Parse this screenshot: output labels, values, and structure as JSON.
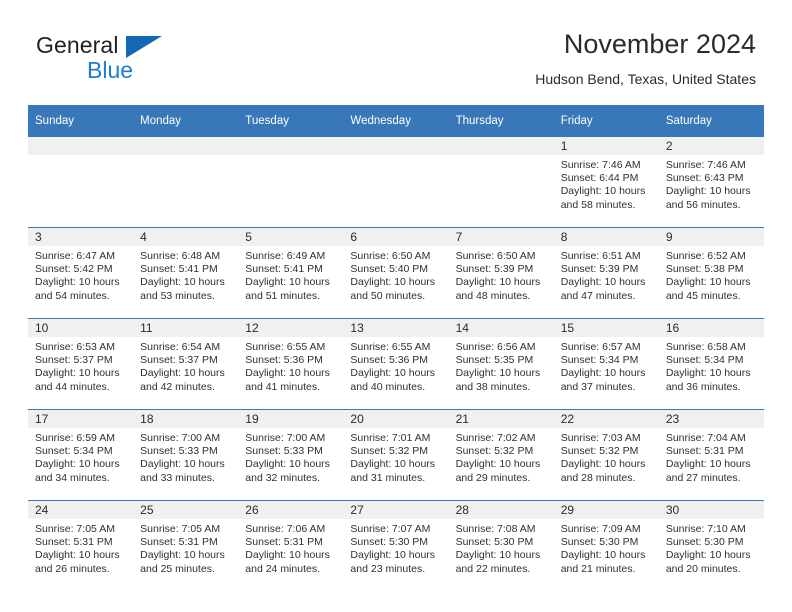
{
  "brand": {
    "name_part1": "General",
    "name_part2": "Blue",
    "triangle_color": "#1268b3",
    "blue_color": "#1a7fd4"
  },
  "header": {
    "title": "November 2024",
    "subtitle": "Hudson Bend, Texas, United States"
  },
  "theme": {
    "header_row_bg": "#3878b8",
    "daynum_band_bg": "#f0f0f0",
    "row_divider": "#3878b8"
  },
  "weekday_headers": [
    "Sunday",
    "Monday",
    "Tuesday",
    "Wednesday",
    "Thursday",
    "Friday",
    "Saturday"
  ],
  "weeks": [
    [
      {
        "day": "",
        "sunrise": "",
        "sunset": "",
        "daylight_line1": "",
        "daylight_line2": ""
      },
      {
        "day": "",
        "sunrise": "",
        "sunset": "",
        "daylight_line1": "",
        "daylight_line2": ""
      },
      {
        "day": "",
        "sunrise": "",
        "sunset": "",
        "daylight_line1": "",
        "daylight_line2": ""
      },
      {
        "day": "",
        "sunrise": "",
        "sunset": "",
        "daylight_line1": "",
        "daylight_line2": ""
      },
      {
        "day": "",
        "sunrise": "",
        "sunset": "",
        "daylight_line1": "",
        "daylight_line2": ""
      },
      {
        "day": "1",
        "sunrise": "Sunrise: 7:46 AM",
        "sunset": "Sunset: 6:44 PM",
        "daylight_line1": "Daylight: 10 hours",
        "daylight_line2": "and 58 minutes."
      },
      {
        "day": "2",
        "sunrise": "Sunrise: 7:46 AM",
        "sunset": "Sunset: 6:43 PM",
        "daylight_line1": "Daylight: 10 hours",
        "daylight_line2": "and 56 minutes."
      }
    ],
    [
      {
        "day": "3",
        "sunrise": "Sunrise: 6:47 AM",
        "sunset": "Sunset: 5:42 PM",
        "daylight_line1": "Daylight: 10 hours",
        "daylight_line2": "and 54 minutes."
      },
      {
        "day": "4",
        "sunrise": "Sunrise: 6:48 AM",
        "sunset": "Sunset: 5:41 PM",
        "daylight_line1": "Daylight: 10 hours",
        "daylight_line2": "and 53 minutes."
      },
      {
        "day": "5",
        "sunrise": "Sunrise: 6:49 AM",
        "sunset": "Sunset: 5:41 PM",
        "daylight_line1": "Daylight: 10 hours",
        "daylight_line2": "and 51 minutes."
      },
      {
        "day": "6",
        "sunrise": "Sunrise: 6:50 AM",
        "sunset": "Sunset: 5:40 PM",
        "daylight_line1": "Daylight: 10 hours",
        "daylight_line2": "and 50 minutes."
      },
      {
        "day": "7",
        "sunrise": "Sunrise: 6:50 AM",
        "sunset": "Sunset: 5:39 PM",
        "daylight_line1": "Daylight: 10 hours",
        "daylight_line2": "and 48 minutes."
      },
      {
        "day": "8",
        "sunrise": "Sunrise: 6:51 AM",
        "sunset": "Sunset: 5:39 PM",
        "daylight_line1": "Daylight: 10 hours",
        "daylight_line2": "and 47 minutes."
      },
      {
        "day": "9",
        "sunrise": "Sunrise: 6:52 AM",
        "sunset": "Sunset: 5:38 PM",
        "daylight_line1": "Daylight: 10 hours",
        "daylight_line2": "and 45 minutes."
      }
    ],
    [
      {
        "day": "10",
        "sunrise": "Sunrise: 6:53 AM",
        "sunset": "Sunset: 5:37 PM",
        "daylight_line1": "Daylight: 10 hours",
        "daylight_line2": "and 44 minutes."
      },
      {
        "day": "11",
        "sunrise": "Sunrise: 6:54 AM",
        "sunset": "Sunset: 5:37 PM",
        "daylight_line1": "Daylight: 10 hours",
        "daylight_line2": "and 42 minutes."
      },
      {
        "day": "12",
        "sunrise": "Sunrise: 6:55 AM",
        "sunset": "Sunset: 5:36 PM",
        "daylight_line1": "Daylight: 10 hours",
        "daylight_line2": "and 41 minutes."
      },
      {
        "day": "13",
        "sunrise": "Sunrise: 6:55 AM",
        "sunset": "Sunset: 5:36 PM",
        "daylight_line1": "Daylight: 10 hours",
        "daylight_line2": "and 40 minutes."
      },
      {
        "day": "14",
        "sunrise": "Sunrise: 6:56 AM",
        "sunset": "Sunset: 5:35 PM",
        "daylight_line1": "Daylight: 10 hours",
        "daylight_line2": "and 38 minutes."
      },
      {
        "day": "15",
        "sunrise": "Sunrise: 6:57 AM",
        "sunset": "Sunset: 5:34 PM",
        "daylight_line1": "Daylight: 10 hours",
        "daylight_line2": "and 37 minutes."
      },
      {
        "day": "16",
        "sunrise": "Sunrise: 6:58 AM",
        "sunset": "Sunset: 5:34 PM",
        "daylight_line1": "Daylight: 10 hours",
        "daylight_line2": "and 36 minutes."
      }
    ],
    [
      {
        "day": "17",
        "sunrise": "Sunrise: 6:59 AM",
        "sunset": "Sunset: 5:34 PM",
        "daylight_line1": "Daylight: 10 hours",
        "daylight_line2": "and 34 minutes."
      },
      {
        "day": "18",
        "sunrise": "Sunrise: 7:00 AM",
        "sunset": "Sunset: 5:33 PM",
        "daylight_line1": "Daylight: 10 hours",
        "daylight_line2": "and 33 minutes."
      },
      {
        "day": "19",
        "sunrise": "Sunrise: 7:00 AM",
        "sunset": "Sunset: 5:33 PM",
        "daylight_line1": "Daylight: 10 hours",
        "daylight_line2": "and 32 minutes."
      },
      {
        "day": "20",
        "sunrise": "Sunrise: 7:01 AM",
        "sunset": "Sunset: 5:32 PM",
        "daylight_line1": "Daylight: 10 hours",
        "daylight_line2": "and 31 minutes."
      },
      {
        "day": "21",
        "sunrise": "Sunrise: 7:02 AM",
        "sunset": "Sunset: 5:32 PM",
        "daylight_line1": "Daylight: 10 hours",
        "daylight_line2": "and 29 minutes."
      },
      {
        "day": "22",
        "sunrise": "Sunrise: 7:03 AM",
        "sunset": "Sunset: 5:32 PM",
        "daylight_line1": "Daylight: 10 hours",
        "daylight_line2": "and 28 minutes."
      },
      {
        "day": "23",
        "sunrise": "Sunrise: 7:04 AM",
        "sunset": "Sunset: 5:31 PM",
        "daylight_line1": "Daylight: 10 hours",
        "daylight_line2": "and 27 minutes."
      }
    ],
    [
      {
        "day": "24",
        "sunrise": "Sunrise: 7:05 AM",
        "sunset": "Sunset: 5:31 PM",
        "daylight_line1": "Daylight: 10 hours",
        "daylight_line2": "and 26 minutes."
      },
      {
        "day": "25",
        "sunrise": "Sunrise: 7:05 AM",
        "sunset": "Sunset: 5:31 PM",
        "daylight_line1": "Daylight: 10 hours",
        "daylight_line2": "and 25 minutes."
      },
      {
        "day": "26",
        "sunrise": "Sunrise: 7:06 AM",
        "sunset": "Sunset: 5:31 PM",
        "daylight_line1": "Daylight: 10 hours",
        "daylight_line2": "and 24 minutes."
      },
      {
        "day": "27",
        "sunrise": "Sunrise: 7:07 AM",
        "sunset": "Sunset: 5:30 PM",
        "daylight_line1": "Daylight: 10 hours",
        "daylight_line2": "and 23 minutes."
      },
      {
        "day": "28",
        "sunrise": "Sunrise: 7:08 AM",
        "sunset": "Sunset: 5:30 PM",
        "daylight_line1": "Daylight: 10 hours",
        "daylight_line2": "and 22 minutes."
      },
      {
        "day": "29",
        "sunrise": "Sunrise: 7:09 AM",
        "sunset": "Sunset: 5:30 PM",
        "daylight_line1": "Daylight: 10 hours",
        "daylight_line2": "and 21 minutes."
      },
      {
        "day": "30",
        "sunrise": "Sunrise: 7:10 AM",
        "sunset": "Sunset: 5:30 PM",
        "daylight_line1": "Daylight: 10 hours",
        "daylight_line2": "and 20 minutes."
      }
    ]
  ]
}
